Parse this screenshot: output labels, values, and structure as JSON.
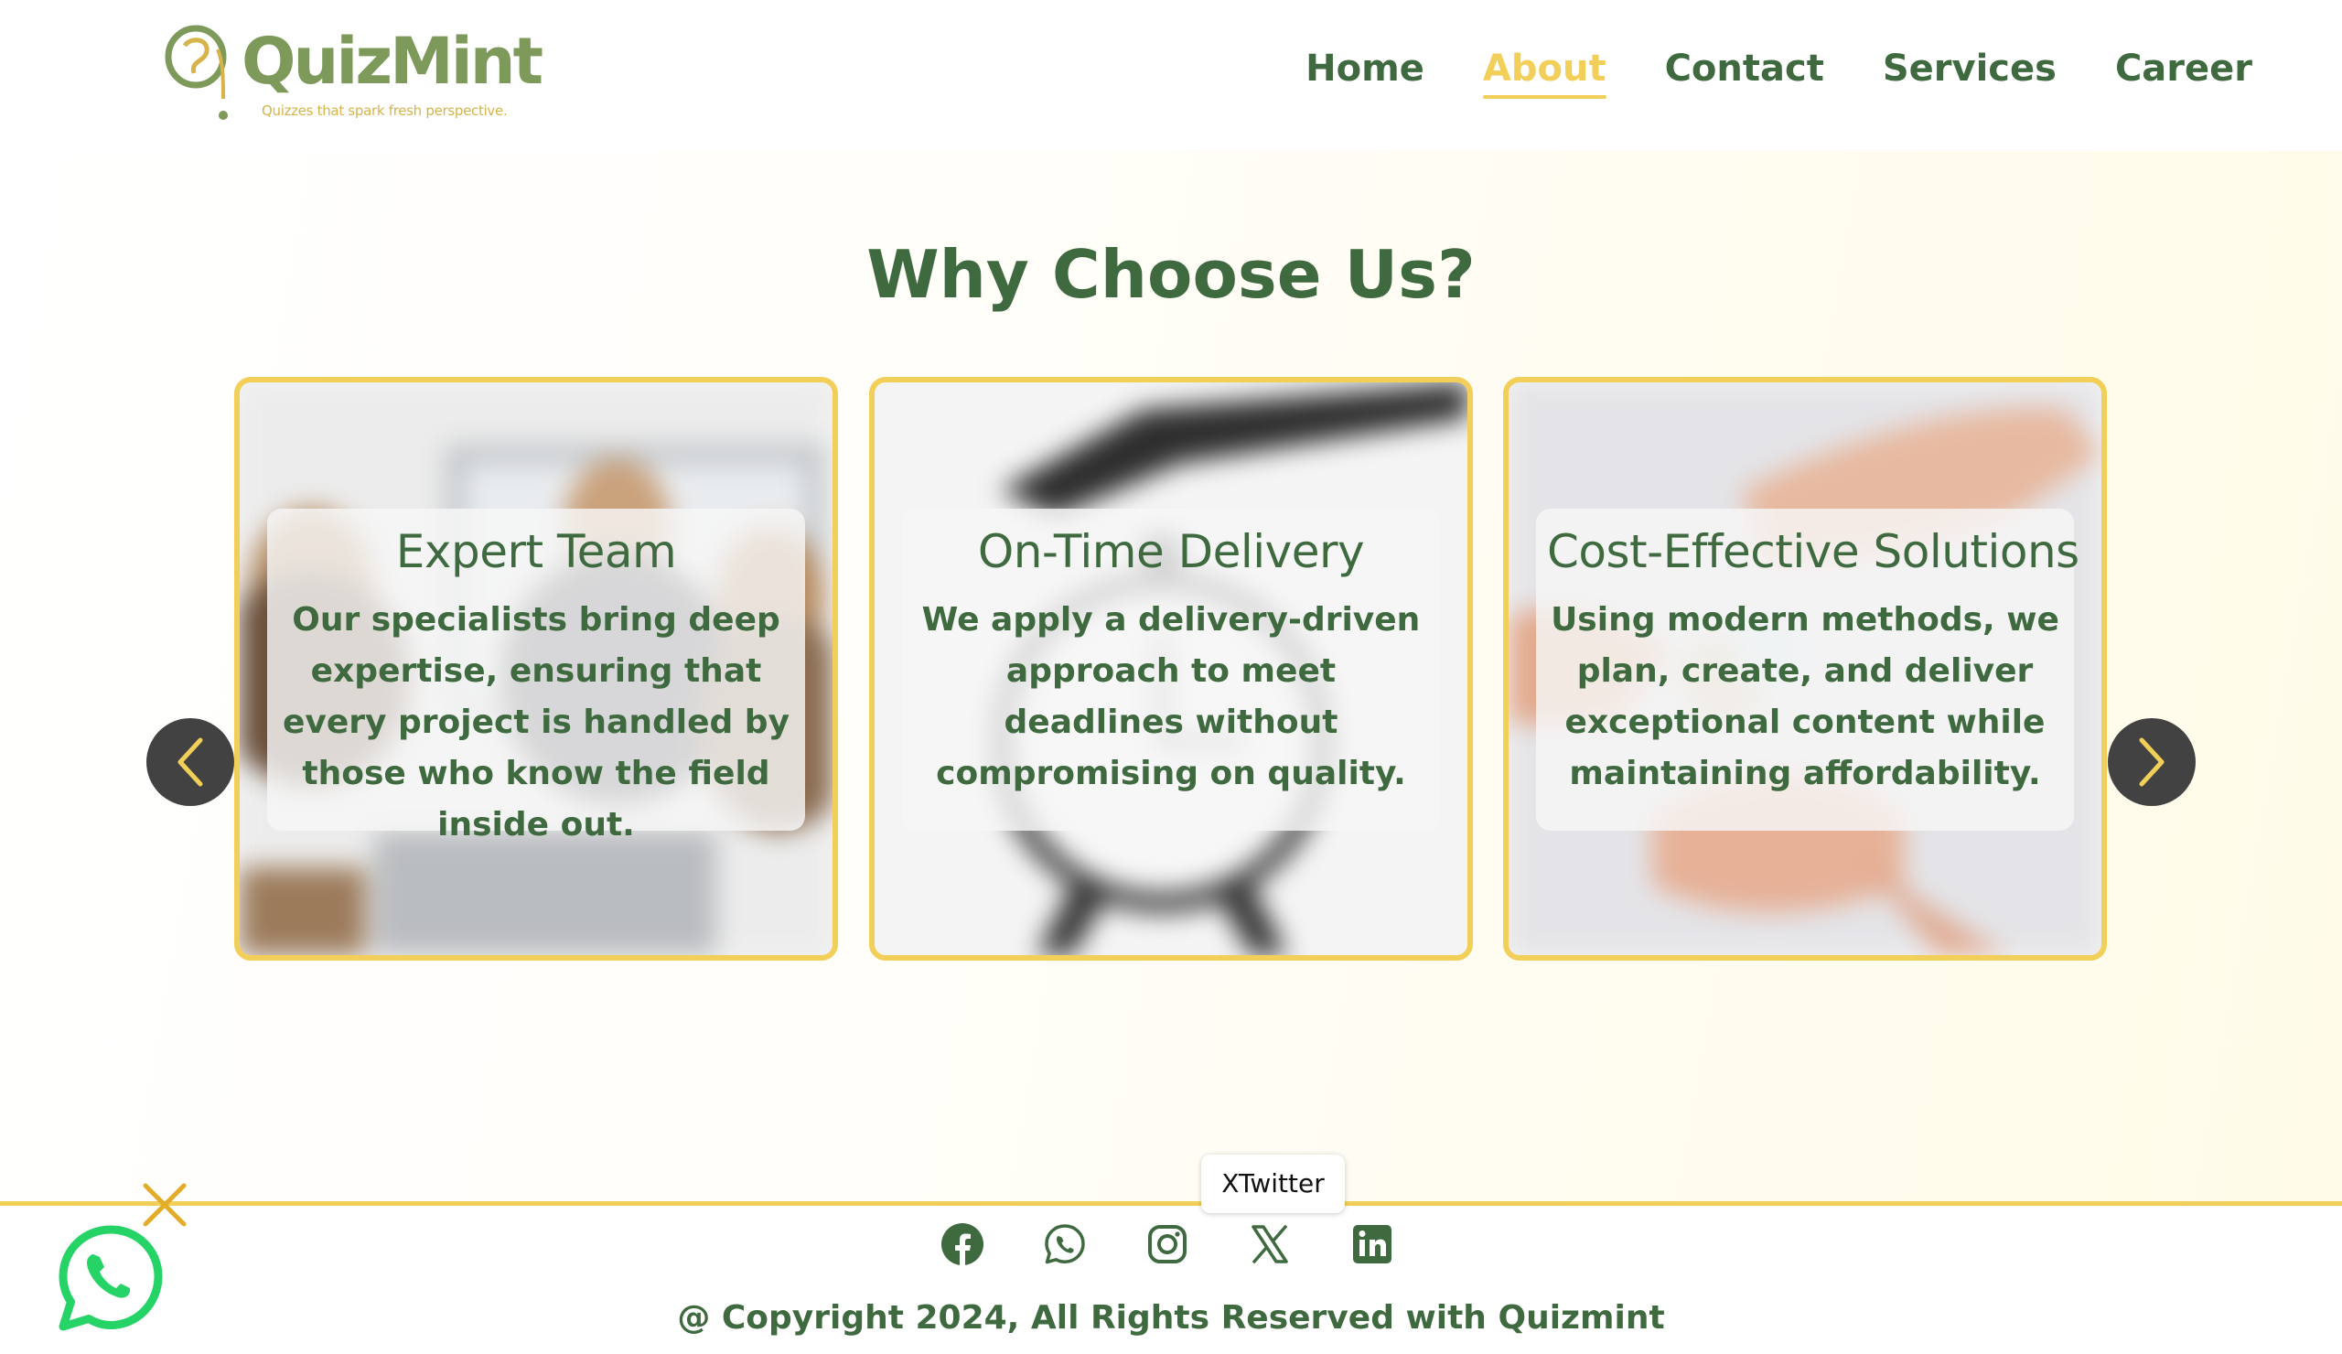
{
  "header": {
    "logo_text": "QuizMint",
    "tagline": "Quizzes that spark fresh perspective."
  },
  "nav": {
    "items": [
      {
        "label": "Home",
        "active": false
      },
      {
        "label": "About",
        "active": true
      },
      {
        "label": "Contact",
        "active": false
      },
      {
        "label": "Services",
        "active": false
      },
      {
        "label": "Career",
        "active": false
      }
    ]
  },
  "main": {
    "title": "Why Choose Us?",
    "cards": [
      {
        "title": "Expert Team",
        "description": "Our specialists bring deep expertise, ensuring that every project is handled by those who know the field inside out."
      },
      {
        "title": "On-Time Delivery",
        "description": "We apply a delivery-driven approach to meet deadlines without compromising on quality."
      },
      {
        "title": "Cost-Effective Solutions",
        "description": "Using modern methods, we plan, create, and deliver exceptional content while maintaining affordability."
      }
    ],
    "prev_icon": "chevron-left-icon",
    "next_icon": "chevron-right-icon"
  },
  "footer": {
    "tooltip": "XTwitter",
    "social": [
      "facebook-icon",
      "whatsapp-icon",
      "instagram-icon",
      "x-twitter-icon",
      "linkedin-icon"
    ],
    "copyright": "@ Copyright 2024, All Rights Reserved with Quizmint"
  },
  "colors": {
    "primary_green": "#3f6a3f",
    "accent_yellow": "#f2cf58",
    "logo_green": "#7e9a5a",
    "whatsapp_green": "#25d366",
    "arrow_bg": "#424242"
  }
}
